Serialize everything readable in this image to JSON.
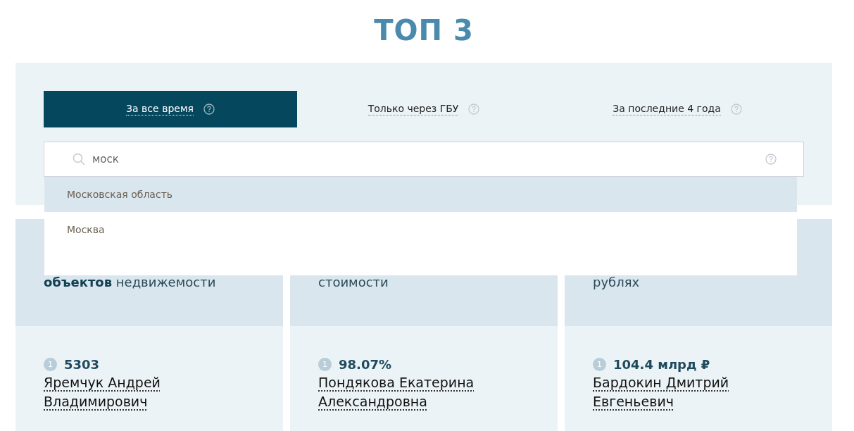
{
  "title": "ТОП 3",
  "tabs": [
    {
      "label": "За все время",
      "selected": true
    },
    {
      "label": "Только через ГБУ",
      "selected": false
    },
    {
      "label": "За последние 4 года",
      "selected": false
    }
  ],
  "search": {
    "value": "моск"
  },
  "suggestions": [
    {
      "label": "Московская область",
      "selected": true
    },
    {
      "label": "Москва",
      "selected": false
    }
  ],
  "cards": [
    {
      "heading": "**объектов** недвижемости",
      "rank": "1",
      "value": "5303",
      "name": "Яремчук Андрей Владимирович"
    },
    {
      "heading": "стоимости",
      "rank": "1",
      "value": "98.07%",
      "name": "Пондякова Екатерина Александровна"
    },
    {
      "heading": "рублях",
      "rank": "1",
      "value": "104.4 млрд ₽",
      "name": "Бардокин Дмитрий Евгеньевич"
    }
  ]
}
